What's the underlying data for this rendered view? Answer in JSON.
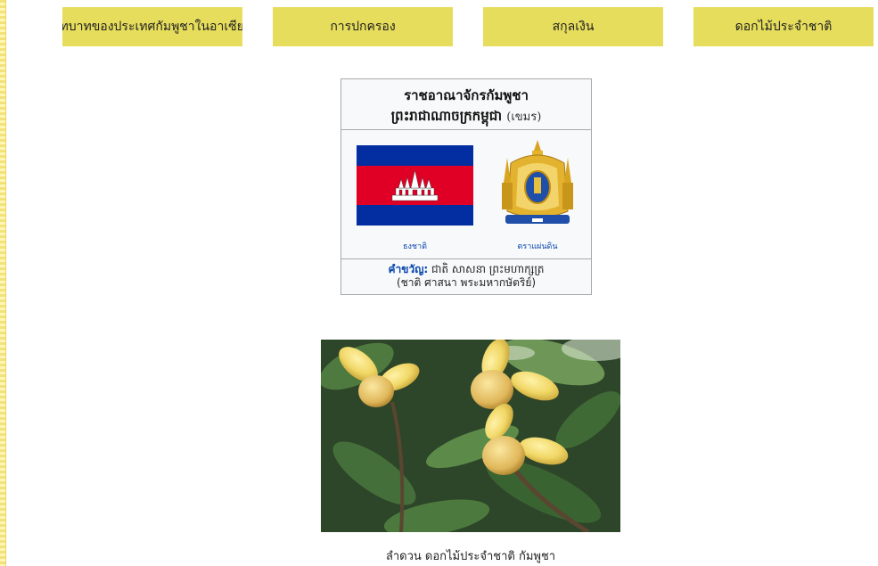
{
  "nav": {
    "items": [
      {
        "label": "บทบาทของประเทศกัมพูชาในอาเซียน"
      },
      {
        "label": "การปกครอง"
      },
      {
        "label": "สกุลเงิน"
      },
      {
        "label": "ดอกไม้ประจำชาติ"
      }
    ]
  },
  "infobox": {
    "title_thai": "ราชอาณาจักรกัมพูชา",
    "title_khmer": "ព្រះរាជាណាចក្រកម្ពុជា",
    "title_lang": "(เขมร)",
    "flag_caption": "ธงชาติ",
    "emblem_caption": "ตราแผ่นดิน",
    "motto_label": "คำขวัญ:",
    "motto_khmer": "ជាតិ សាសនា ព្រះមហាក្សត្រ",
    "motto_thai": "(ชาติ ศาสนา พระมหากษัตริย์)"
  },
  "flower": {
    "caption": "ลำดวน  ดอกไม้ประจำชาติ  กัมพูชา"
  },
  "colors": {
    "nav_button": "#e6dd5c",
    "flag_blue": "#032ea1",
    "flag_red": "#e00025",
    "link": "#0645ad"
  }
}
